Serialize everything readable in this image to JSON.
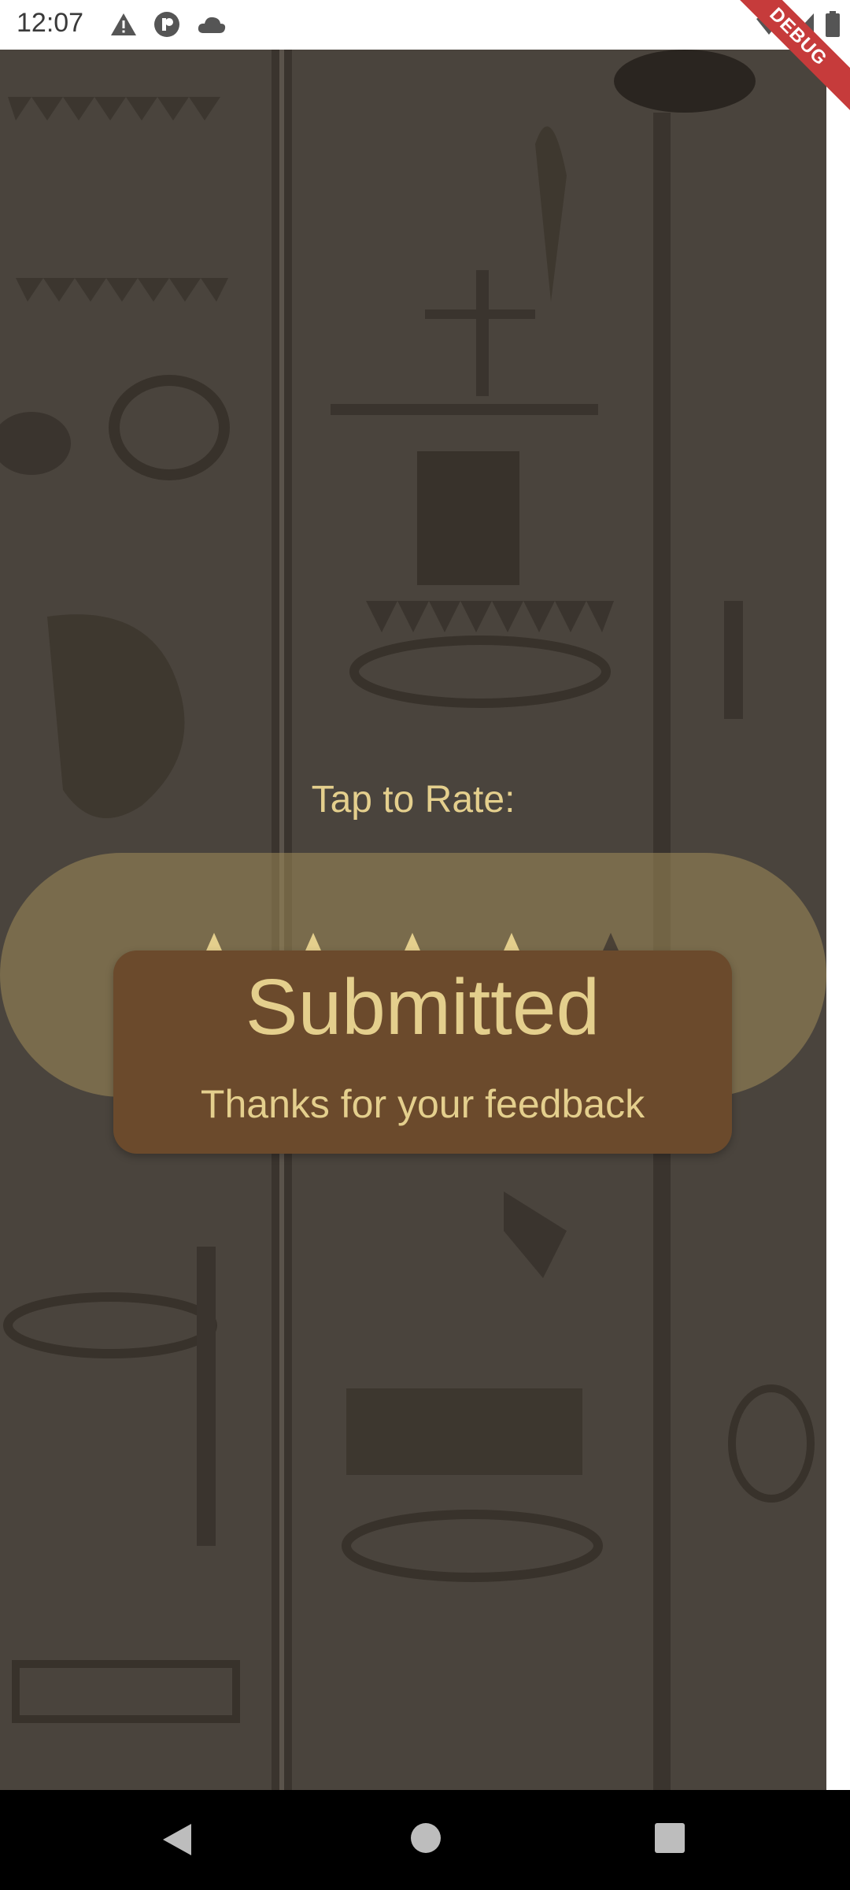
{
  "status_bar": {
    "time": "12:07",
    "left_icons": [
      "warning-icon",
      "app-notification-icon",
      "cloud-icon"
    ],
    "right_icons": [
      "wifi-icon",
      "signal-icon",
      "battery-icon"
    ]
  },
  "debug_banner": {
    "label": "DEBUG"
  },
  "rating": {
    "prompt": "Tap to Rate:",
    "max_stars": 5,
    "selected_stars": 4,
    "star_filled_color": "#e4cf8d",
    "star_empty_color": "#4a4136"
  },
  "toast": {
    "title": "Submitted",
    "message": "Thanks for your feedback"
  },
  "nav_bar": {
    "buttons": [
      "back-icon",
      "home-icon",
      "recents-icon"
    ]
  },
  "colors": {
    "background": "#4a443d",
    "accent": "#e4cf8d",
    "toast_background": "#6b4a2c"
  }
}
